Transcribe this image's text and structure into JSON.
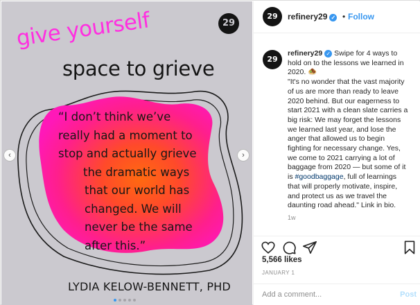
{
  "image": {
    "headline_line1": "give yourself",
    "headline_line2": "space to grieve",
    "quote_lines": [
      "“I don’t think we’ve",
      "really had a moment to",
      "stop and actually grieve",
      "the dramatic ways",
      "that our world has",
      "changed. We will",
      "never be the same",
      "after this.”"
    ],
    "author": "LYDIA KELOW-BENNETT, PHD",
    "logo_text": "29",
    "carousel_count": 5,
    "carousel_active_index": 0,
    "colors": {
      "background": "#cbc9cf",
      "blob_outer": "#ff1fa0",
      "blob_inner": "#ff5a1a",
      "headline_pink": "#ff2fe0"
    }
  },
  "carousel": {
    "prev_icon": "chevron-left-icon",
    "next_icon": "chevron-right-icon",
    "prev_glyph": "‹",
    "next_glyph": "›"
  },
  "header": {
    "avatar_text": "29",
    "username": "refinery29",
    "verified_glyph": "✓",
    "separator": "•",
    "follow_label": "Follow"
  },
  "caption": {
    "avatar_text": "29",
    "username": "refinery29",
    "verified_glyph": "✓",
    "lines": [
      "Swipe for 4 ways to",
      "hold on to the lessons we learned in",
      "2020. 🧆",
      "\"It's no wonder that the vast majority",
      "of us are more than ready to leave",
      "2020 behind. But our eagerness to",
      "start 2021 with a clean slate carries a",
      "big risk: We may forget the lessons",
      "we learned last year, and lose the",
      "anger that allowed us to begin",
      "fighting for necessary change. Yes,",
      "we come to 2021 carrying a lot of",
      "baggage from 2020 — but some of it"
    ],
    "line14_prefix": "is ",
    "hashtag": "#goodbaggage",
    "line14_suffix": ", full of learnings",
    "tail_lines": [
      "that will properly motivate, inspire,",
      "and protect us as we travel the",
      "daunting road ahead.\" Link in bio."
    ],
    "time_ago": "1w"
  },
  "actions": {
    "like_icon": "heart-icon",
    "comment_icon": "comment-icon",
    "share_icon": "share-icon",
    "save_icon": "bookmark-icon"
  },
  "likes": "5,566 likes",
  "date": "JANUARY 1",
  "comment_box": {
    "placeholder": "Add a comment...",
    "post_label": "Post"
  }
}
